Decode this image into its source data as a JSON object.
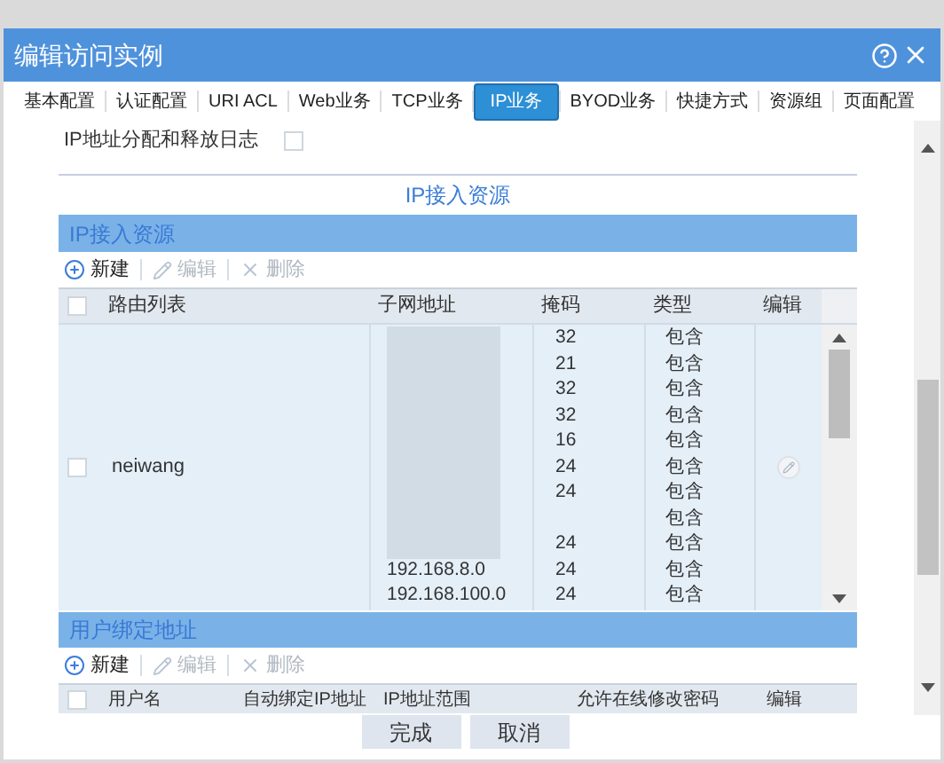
{
  "window": {
    "title": "编辑访问实例"
  },
  "tabs": [
    {
      "label": "基本配置",
      "selected": false
    },
    {
      "label": "认证配置",
      "selected": false
    },
    {
      "label": "URI ACL",
      "selected": false
    },
    {
      "label": "Web业务",
      "selected": false
    },
    {
      "label": "TCP业务",
      "selected": false
    },
    {
      "label": "IP业务",
      "selected": true
    },
    {
      "label": "BYOD业务",
      "selected": false
    },
    {
      "label": "快捷方式",
      "selected": false
    },
    {
      "label": "资源组",
      "selected": false
    },
    {
      "label": "页面配置",
      "selected": false
    }
  ],
  "ip_log": {
    "label": "IP地址分配和释放日志",
    "checked": false
  },
  "section_title": "IP接入资源",
  "ip_resources": {
    "title": "IP接入资源",
    "toolbar": [
      {
        "kind": "add",
        "label": "新建",
        "disabled": false
      },
      {
        "kind": "edit",
        "label": "编辑",
        "disabled": true
      },
      {
        "kind": "delete",
        "label": "删除",
        "disabled": true
      }
    ],
    "columns": [
      "路由列表",
      "子网地址",
      "掩码",
      "类型",
      "编辑"
    ],
    "all_checked": false,
    "rows": [
      {
        "route": "neiwang",
        "checked": false,
        "subnets": [
          {
            "mask": "32",
            "type": "包含"
          },
          {
            "mask": "21",
            "type": "包含"
          },
          {
            "mask": "32",
            "type": "包含"
          },
          {
            "mask": "32",
            "type": "包含"
          },
          {
            "mask": "16",
            "type": "包含"
          },
          {
            "mask": "24",
            "type": "包含"
          },
          {
            "mask": "24",
            "type": "包含"
          },
          {
            "type": "包含"
          },
          {
            "mask": "24",
            "type": "包含"
          },
          {
            "subnet": "192.168.8.0",
            "mask": "24",
            "type": "包含"
          },
          {
            "subnet": "192.168.100.0",
            "mask": "24",
            "type": "包含"
          }
        ]
      }
    ]
  },
  "user_binding": {
    "title": "用户绑定地址",
    "toolbar": [
      {
        "kind": "add",
        "label": "新建",
        "disabled": false
      },
      {
        "kind": "edit",
        "label": "编辑",
        "disabled": true
      },
      {
        "kind": "delete",
        "label": "删除",
        "disabled": true
      }
    ],
    "columns": [
      "用户名",
      "自动绑定IP地址",
      "IP地址范围",
      "允许在线修改密码",
      "编辑"
    ],
    "all_checked": false
  },
  "buttons": [
    "完成",
    "取消"
  ]
}
